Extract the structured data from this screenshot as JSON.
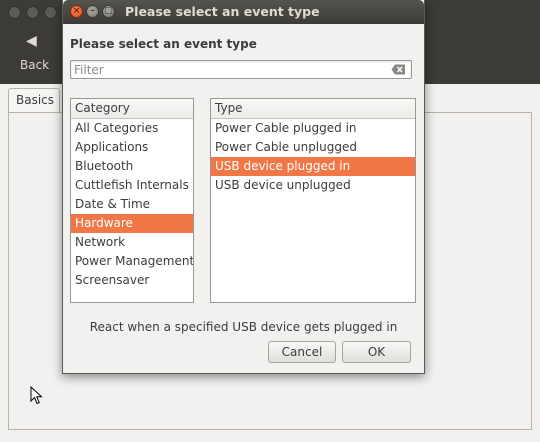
{
  "background_window": {
    "back_icon": "back-arrow-icon",
    "back_label": "Back",
    "tab_label": "Basics"
  },
  "dialog": {
    "title": "Please select an event type",
    "heading": "Please select an event type",
    "filter": {
      "placeholder": "Filter",
      "value": ""
    },
    "category": {
      "header": "Category",
      "items": [
        "All Categories",
        "Applications",
        "Bluetooth",
        "Cuttlefish Internals",
        "Date & Time",
        "Hardware",
        "Network",
        "Power Management",
        "Screensaver"
      ],
      "selected": "Hardware"
    },
    "type": {
      "header": "Type",
      "items": [
        "Power Cable plugged in",
        "Power Cable unplugged",
        "USB device plugged in",
        "USB device unplugged"
      ],
      "selected": "USB device plugged in"
    },
    "description": "React when a specified USB device gets plugged in",
    "cancel_label": "Cancel",
    "ok_label": "OK"
  },
  "colors": {
    "selection": "#f07746",
    "titlebar": "#3c3b37",
    "close_button": "#df4a17"
  }
}
